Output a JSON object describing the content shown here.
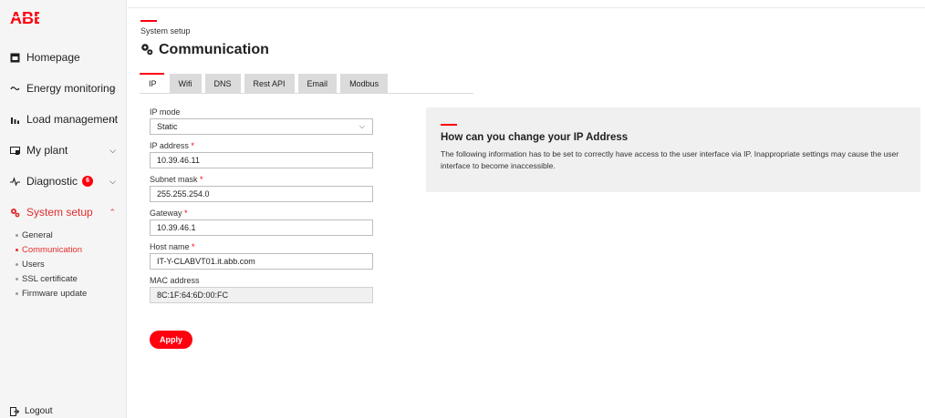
{
  "brand": {
    "logo_text": "ABB",
    "accent": "#ff000f"
  },
  "sidebar": {
    "items": [
      {
        "label": "Homepage",
        "icon": "homepage-icon",
        "active": false
      },
      {
        "label": "Energy monitoring",
        "icon": "energy-monitoring-icon",
        "active": false
      },
      {
        "label": "Load management",
        "icon": "load-management-icon",
        "active": false
      },
      {
        "label": "My plant",
        "icon": "my-plant-icon",
        "active": false
      },
      {
        "label": "Diagnostic",
        "icon": "diagnostic-icon",
        "active": false,
        "badge": "6"
      },
      {
        "label": "System setup",
        "icon": "system-setup-icon",
        "active": true
      }
    ],
    "sub_items": [
      {
        "label": "General",
        "active": false
      },
      {
        "label": "Communication",
        "active": true
      },
      {
        "label": "Users",
        "active": false
      },
      {
        "label": "SSL certificate",
        "active": false
      },
      {
        "label": "Firmware update",
        "active": false
      }
    ],
    "logout_label": "Logout"
  },
  "header": {
    "breadcrumb": "System setup",
    "title": "Communication"
  },
  "tabs": [
    {
      "label": "IP",
      "active": true
    },
    {
      "label": "Wifi"
    },
    {
      "label": "DNS"
    },
    {
      "label": "Rest API"
    },
    {
      "label": "Email"
    },
    {
      "label": "Modbus"
    }
  ],
  "form": {
    "ip_mode": {
      "label": "IP mode",
      "value": "Static"
    },
    "ip_address": {
      "label": "IP address",
      "value": "10.39.46.11"
    },
    "subnet_mask": {
      "label": "Subnet mask",
      "value": "255.255.254.0"
    },
    "gateway": {
      "label": "Gateway",
      "value": "10.39.46.1"
    },
    "host_name": {
      "label": "Host name",
      "value": "IT-Y-CLABVT01.it.abb.com"
    },
    "mac_address": {
      "label": "MAC address",
      "value": "8C:1F:64:6D:00:FC"
    },
    "required_mark": "*",
    "apply_label": "Apply"
  },
  "info": {
    "title": "How can you change your IP Address",
    "text": "The following information has to be set to correctly have access to the user interface via IP. Inappropriate settings may cause the user interface to become inaccessible."
  }
}
